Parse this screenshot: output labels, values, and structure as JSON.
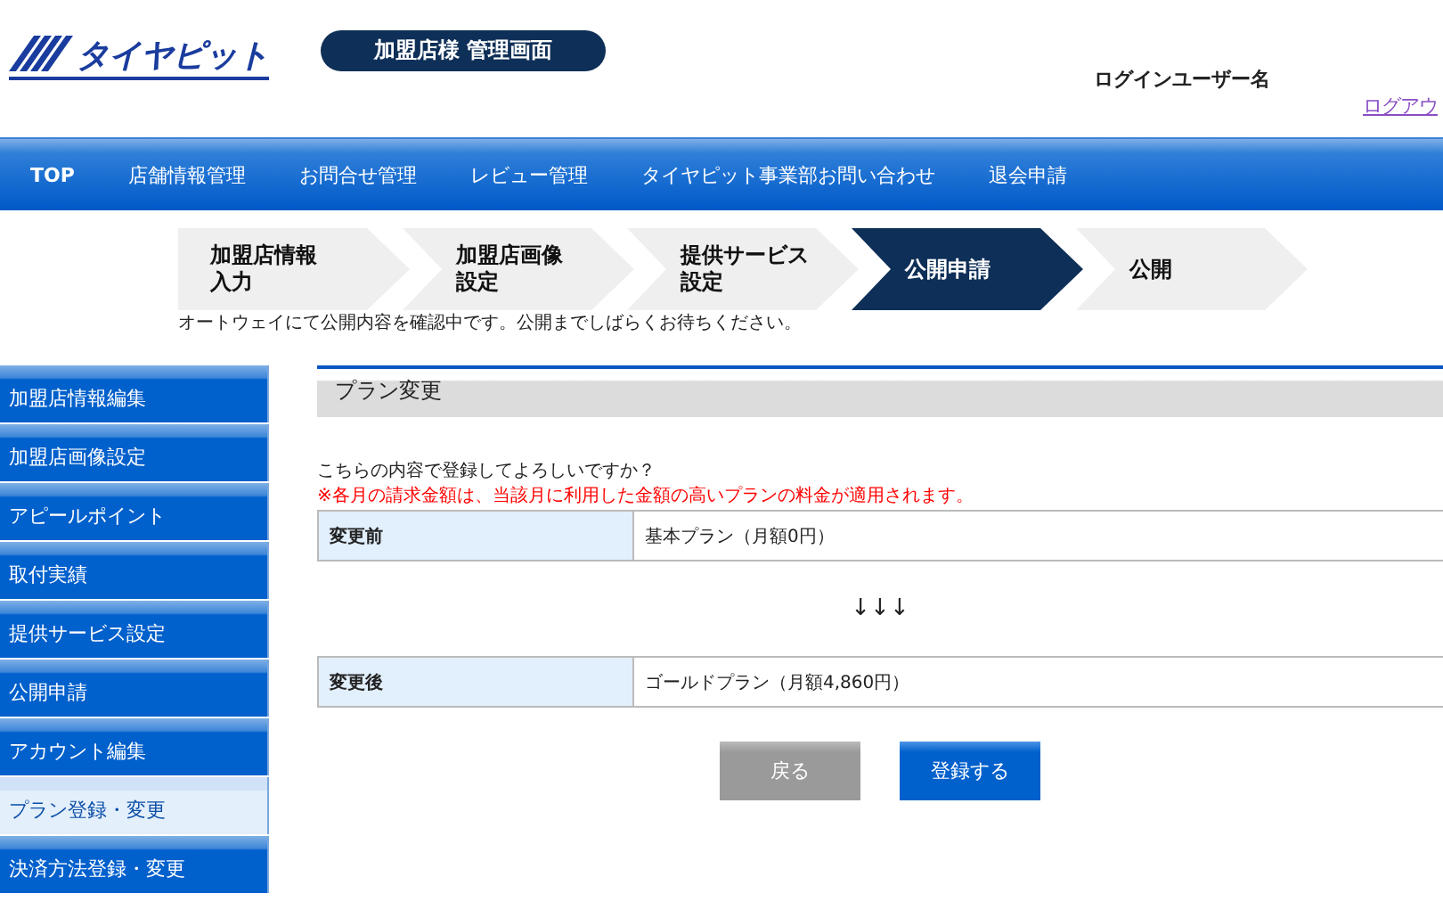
{
  "header": {
    "logo": "タイヤピット",
    "badge": "加盟店様 管理画面",
    "user": "ログインユーザー名",
    "logout": "ログアウ"
  },
  "nav": [
    "TOP",
    "店舗情報管理",
    "お問合せ管理",
    "レビュー管理",
    "タイヤピット事業部お問い合わせ",
    "退会申請"
  ],
  "steps": [
    {
      "label": "加盟店情報入力",
      "selected": false
    },
    {
      "label": "加盟店画像設定",
      "selected": false
    },
    {
      "label": "提供サービス設定",
      "selected": false
    },
    {
      "label": "公開申請",
      "selected": true
    },
    {
      "label": "公開",
      "selected": false
    }
  ],
  "notice": "オートウェイにて公開内容を確認中です。公開までしばらくお待ちください。",
  "sidebar": {
    "items": [
      {
        "label": "加盟店情報編集",
        "selected": false
      },
      {
        "label": "加盟店画像設定",
        "selected": false
      },
      {
        "label": "アピールポイント",
        "selected": false
      },
      {
        "label": "取付実績",
        "selected": false
      },
      {
        "label": "提供サービス設定",
        "selected": false
      },
      {
        "label": "公開申請",
        "selected": false
      },
      {
        "label": "アカウント編集",
        "selected": false
      },
      {
        "label": "プラン登録・変更",
        "selected": true
      },
      {
        "label": "決済方法登録・変更",
        "selected": false
      }
    ]
  },
  "main": {
    "heading": "プラン変更",
    "question": "こちらの内容で登録してよろしいですか？",
    "warning": "※各月の請求金額は、当該月に利用した金額の高いプランの料金が適用されます。",
    "before": {
      "label": "変更前",
      "value": "基本プラン（月額0円）"
    },
    "arrows": "↓↓↓",
    "after": {
      "label": "変更後",
      "value": "ゴールドプラン（月額4,860円）"
    },
    "buttons": [
      {
        "label": "戻る",
        "kind": "back"
      },
      {
        "label": "登録する",
        "kind": "submit"
      }
    ]
  }
}
